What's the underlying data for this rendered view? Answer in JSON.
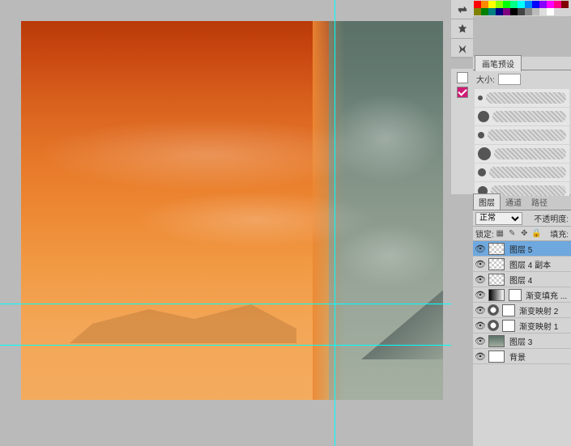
{
  "guides": {
    "v1": 413,
    "h1": 375,
    "h2": 426
  },
  "brush_panel": {
    "tab_label": "画笔预设",
    "size_label": "大小:"
  },
  "layers_panel": {
    "tabs": [
      "图层",
      "通道",
      "路径"
    ],
    "blend_mode": "正常",
    "opacity_label": "不透明度:",
    "lock_label": "锁定:",
    "fill_label": "填充:",
    "layers": [
      {
        "name": "图层 5",
        "selected": true
      },
      {
        "name": "图层 4 副本"
      },
      {
        "name": "图层 4"
      },
      {
        "name": "渐变填充 ..."
      },
      {
        "name": "渐变映射 2"
      },
      {
        "name": "渐变映射 1"
      },
      {
        "name": "图层 3"
      },
      {
        "name": "背景"
      }
    ]
  }
}
